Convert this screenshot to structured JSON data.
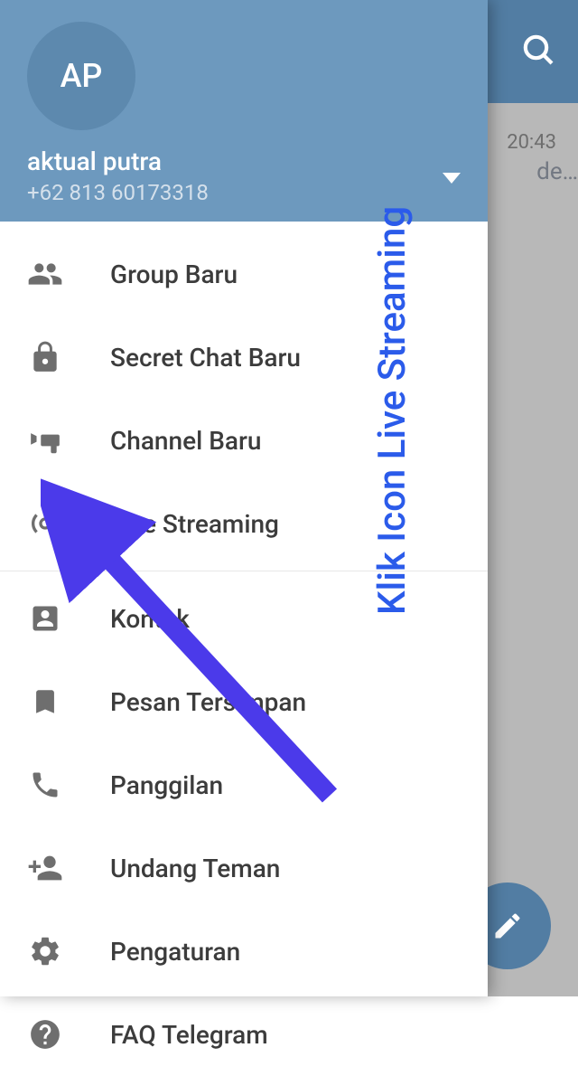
{
  "avatar_initials": "AP",
  "user_name": "aktual putra",
  "user_phone": "+62 813 60173318",
  "chat_time": "20:43",
  "chat_preview": "de…",
  "menu": {
    "group": "Group Baru",
    "secret": "Secret Chat Baru",
    "channel": "Channel Baru",
    "live": "Live Streaming",
    "contacts": "Kontak",
    "saved": "Pesan Tersimpan",
    "calls": "Panggilan",
    "invite": "Undang Teman",
    "settings": "Pengaturan",
    "faq": "FAQ Telegram"
  },
  "annotation": "Klik Icon Live Streaming"
}
